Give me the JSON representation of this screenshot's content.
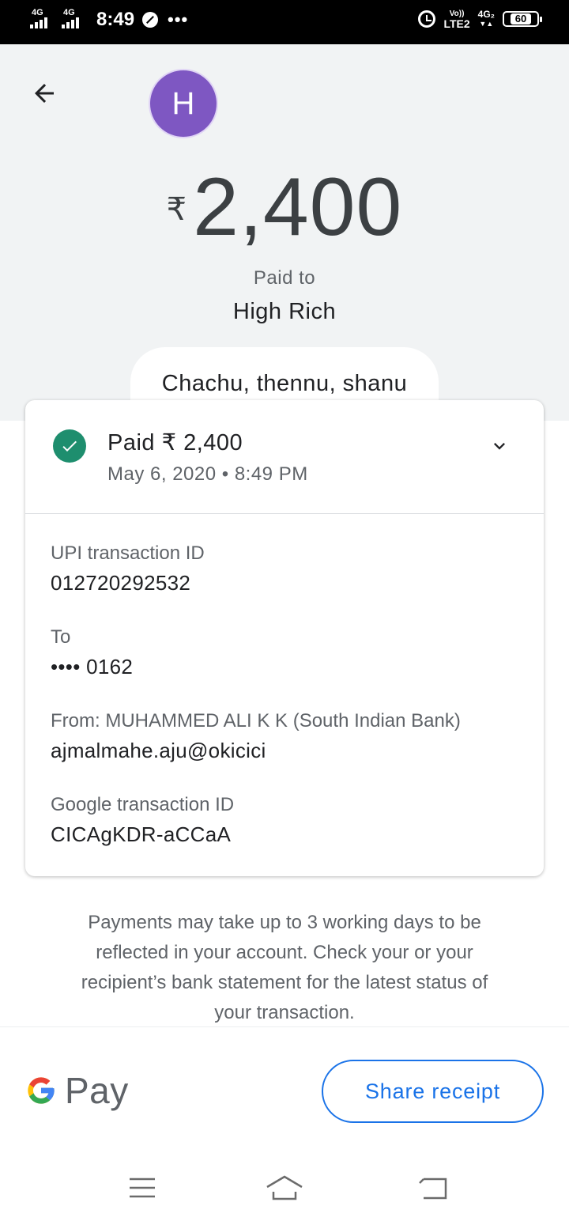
{
  "status_bar": {
    "sim1": "4G",
    "sim2": "4G",
    "time": "8:49",
    "more": "•••",
    "volte_top": "Vo))",
    "volte_bottom": "LTE2",
    "net_top": "4G₂",
    "battery": "60"
  },
  "header": {
    "avatar_letter": "H",
    "currency": "₹",
    "amount": "2,400",
    "paid_to_label": "Paid to",
    "payee": "High Rich",
    "note": "Chachu, thennu, shanu"
  },
  "card": {
    "status": "Paid ₹ 2,400",
    "datetime": "May 6, 2020 • 8:49 PM",
    "fields": [
      {
        "label": "UPI transaction ID",
        "value": "012720292532"
      },
      {
        "label": "To",
        "value": "•••• 0162"
      },
      {
        "label": "From: MUHAMMED ALI K K (South Indian Bank)",
        "value": "ajmalmahe.aju@okicici"
      },
      {
        "label": "Google transaction ID",
        "value": "CICAgKDR-aCCaA"
      }
    ]
  },
  "disclaimer": "Payments may take up to 3 working days to be reflected in your account. Check your or your recipient’s bank statement for the latest status of your transaction.",
  "footer": {
    "brand_word": "Pay",
    "share_label": "Share receipt"
  },
  "colors": {
    "accent": "#1a73e8",
    "avatar": "#7e57c2",
    "success": "#1e8e6e",
    "hero_bg": "#f1f3f4"
  },
  "icons": {
    "back": "arrow-left-icon",
    "check": "check-circle-icon",
    "expand": "chevron-down-icon",
    "menu": "menu-icon",
    "home": "home-icon",
    "return": "return-icon"
  }
}
